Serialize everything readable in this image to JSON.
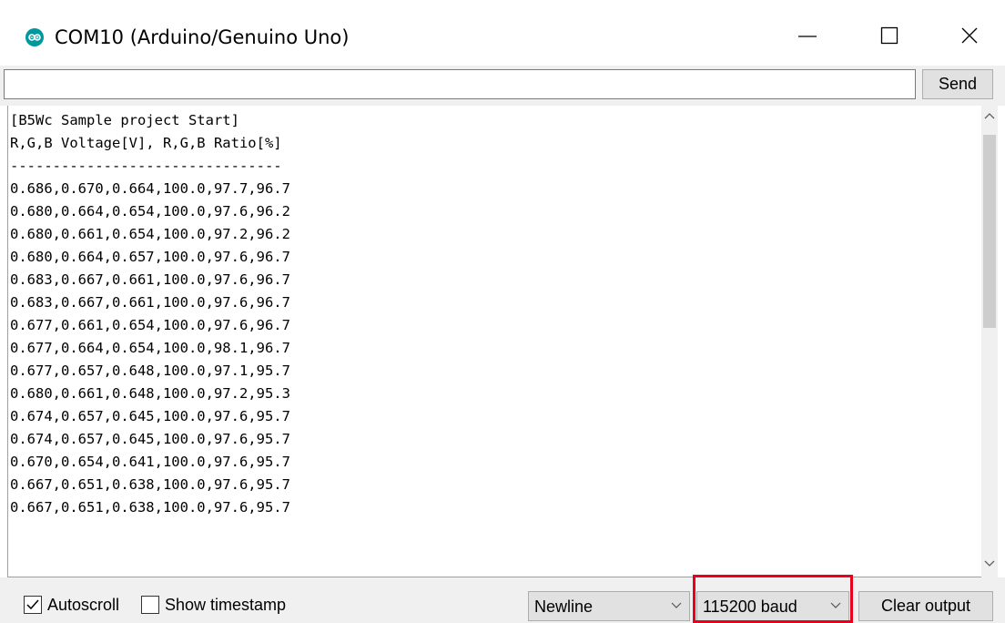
{
  "window": {
    "title": "COM10 (Arduino/Genuino Uno)",
    "icon": "arduino-icon",
    "accent_color": "#00979d"
  },
  "send_row": {
    "input_value": "",
    "send_label": "Send"
  },
  "output": {
    "lines": [
      "[B5Wc Sample project Start]",
      "R,G,B Voltage[V], R,G,B Ratio[%]",
      "--------------------------------",
      "0.686,0.670,0.664,100.0,97.7,96.7",
      "0.680,0.664,0.654,100.0,97.6,96.2",
      "0.680,0.661,0.654,100.0,97.2,96.2",
      "0.680,0.664,0.657,100.0,97.6,96.7",
      "0.683,0.667,0.661,100.0,97.6,96.7",
      "0.683,0.667,0.661,100.0,97.6,96.7",
      "0.677,0.661,0.654,100.0,97.6,96.7",
      "0.677,0.664,0.654,100.0,98.1,96.7",
      "0.677,0.657,0.648,100.0,97.1,95.7",
      "0.680,0.661,0.648,100.0,97.2,95.3",
      "0.674,0.657,0.645,100.0,97.6,95.7",
      "0.674,0.657,0.645,100.0,97.6,95.7",
      "0.670,0.654,0.641,100.0,97.6,95.7",
      "0.667,0.651,0.638,100.0,97.6,95.7",
      "0.667,0.651,0.638,100.0,97.6,95.7"
    ]
  },
  "bottom_bar": {
    "autoscroll_label": "Autoscroll",
    "autoscroll_checked": true,
    "timestamp_label": "Show timestamp",
    "timestamp_checked": false,
    "line_ending": "Newline",
    "baud_rate": "115200 baud",
    "clear_label": "Clear output",
    "highlight_color": "#e8001c"
  }
}
